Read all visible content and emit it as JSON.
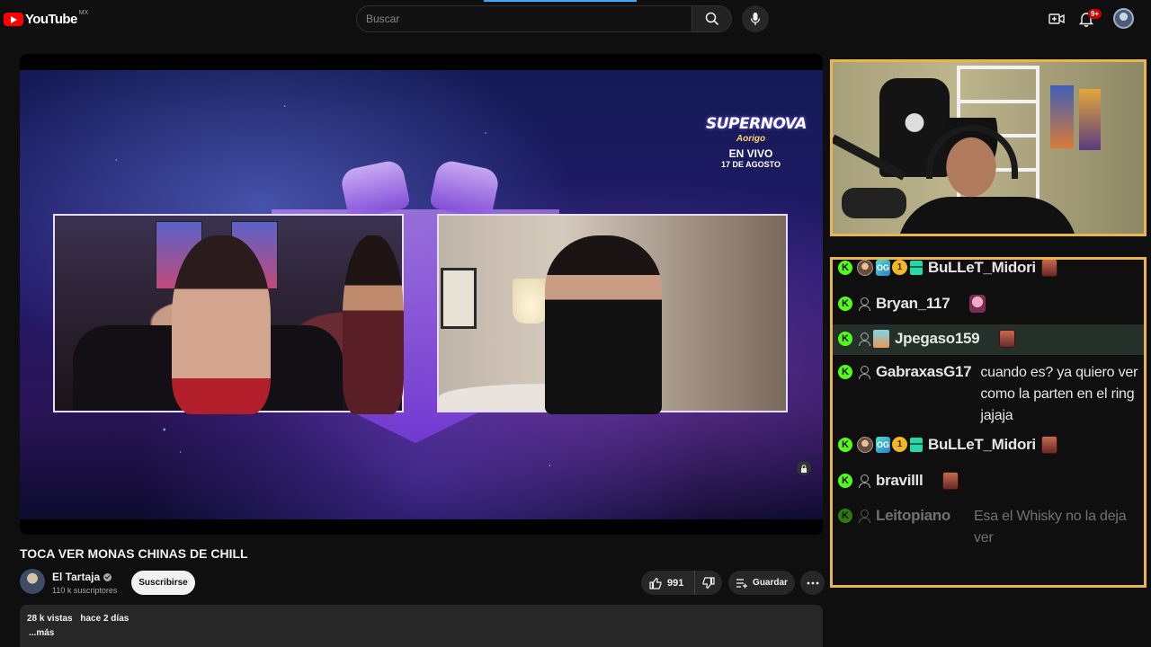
{
  "app": {
    "logo_text": "YouTube",
    "region": "MX",
    "search_placeholder": "Buscar",
    "notification_count": "9+"
  },
  "overlay": {
    "event_title": "SUPERNOVA",
    "event_brand": "Aorigo",
    "event_live": "EN VIVO",
    "event_date": "17 DE AGOSTO"
  },
  "video": {
    "title": "TOCA VER MONAS CHINAS DE CHILL",
    "channel_name": "El Tartaja",
    "subscribers": "110 k suscriptores",
    "subscribe_label": "Suscribirse",
    "likes": "991",
    "save_label": "Guardar",
    "views": "28 k vistas",
    "uploaded": "hace 2 días",
    "more_label": "...más"
  },
  "chat": {
    "messages": [
      {
        "user": "BuLLeT_Midori",
        "text": ""
      },
      {
        "user": "Bryan_117",
        "text": ""
      },
      {
        "user": "Jpegaso159",
        "text": ""
      },
      {
        "user": "GabraxasG17",
        "text": "cuando es? ya quiero ver como la parten en el ring jajaja"
      },
      {
        "user": "BuLLeT_Midori",
        "text": ""
      },
      {
        "user": "bravilll",
        "text": ""
      },
      {
        "user": "Leitopiano",
        "text": "Esa el Whisky no la deja ver"
      }
    ],
    "badge_og": "OG",
    "badge_one": "1",
    "kick_glyph": "K"
  },
  "colors": {
    "accent_red": "#ff0000",
    "kick_green": "#53fc18",
    "overlay_border": "#e8b64c",
    "progress_blue": "#3ea6ff"
  }
}
